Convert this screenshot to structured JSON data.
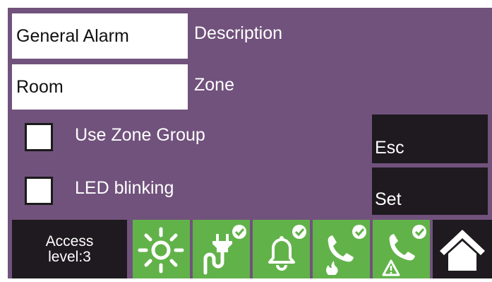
{
  "form": {
    "description_value": "General Alarm",
    "description_label": "Description",
    "zone_value": "Room",
    "zone_label": "Zone",
    "use_zone_group_label": "Use Zone Group",
    "use_zone_group_checked": false,
    "led_blinking_label": "LED blinking",
    "led_blinking_checked": false
  },
  "actions": {
    "esc_label": "Esc",
    "set_label": "Set"
  },
  "bottom_bar": {
    "access_line1": "Access",
    "access_line2": "level:3",
    "status_icons": [
      "sun-icon",
      "power-plug-icon",
      "bell-icon",
      "phone-fire-icon",
      "phone-warning-icon"
    ],
    "home_icon": "home-icon"
  },
  "colors": {
    "background": "#71527c",
    "field": "#ffffff",
    "button_dark": "#1e1a1f",
    "status_green": "#62b24a"
  }
}
